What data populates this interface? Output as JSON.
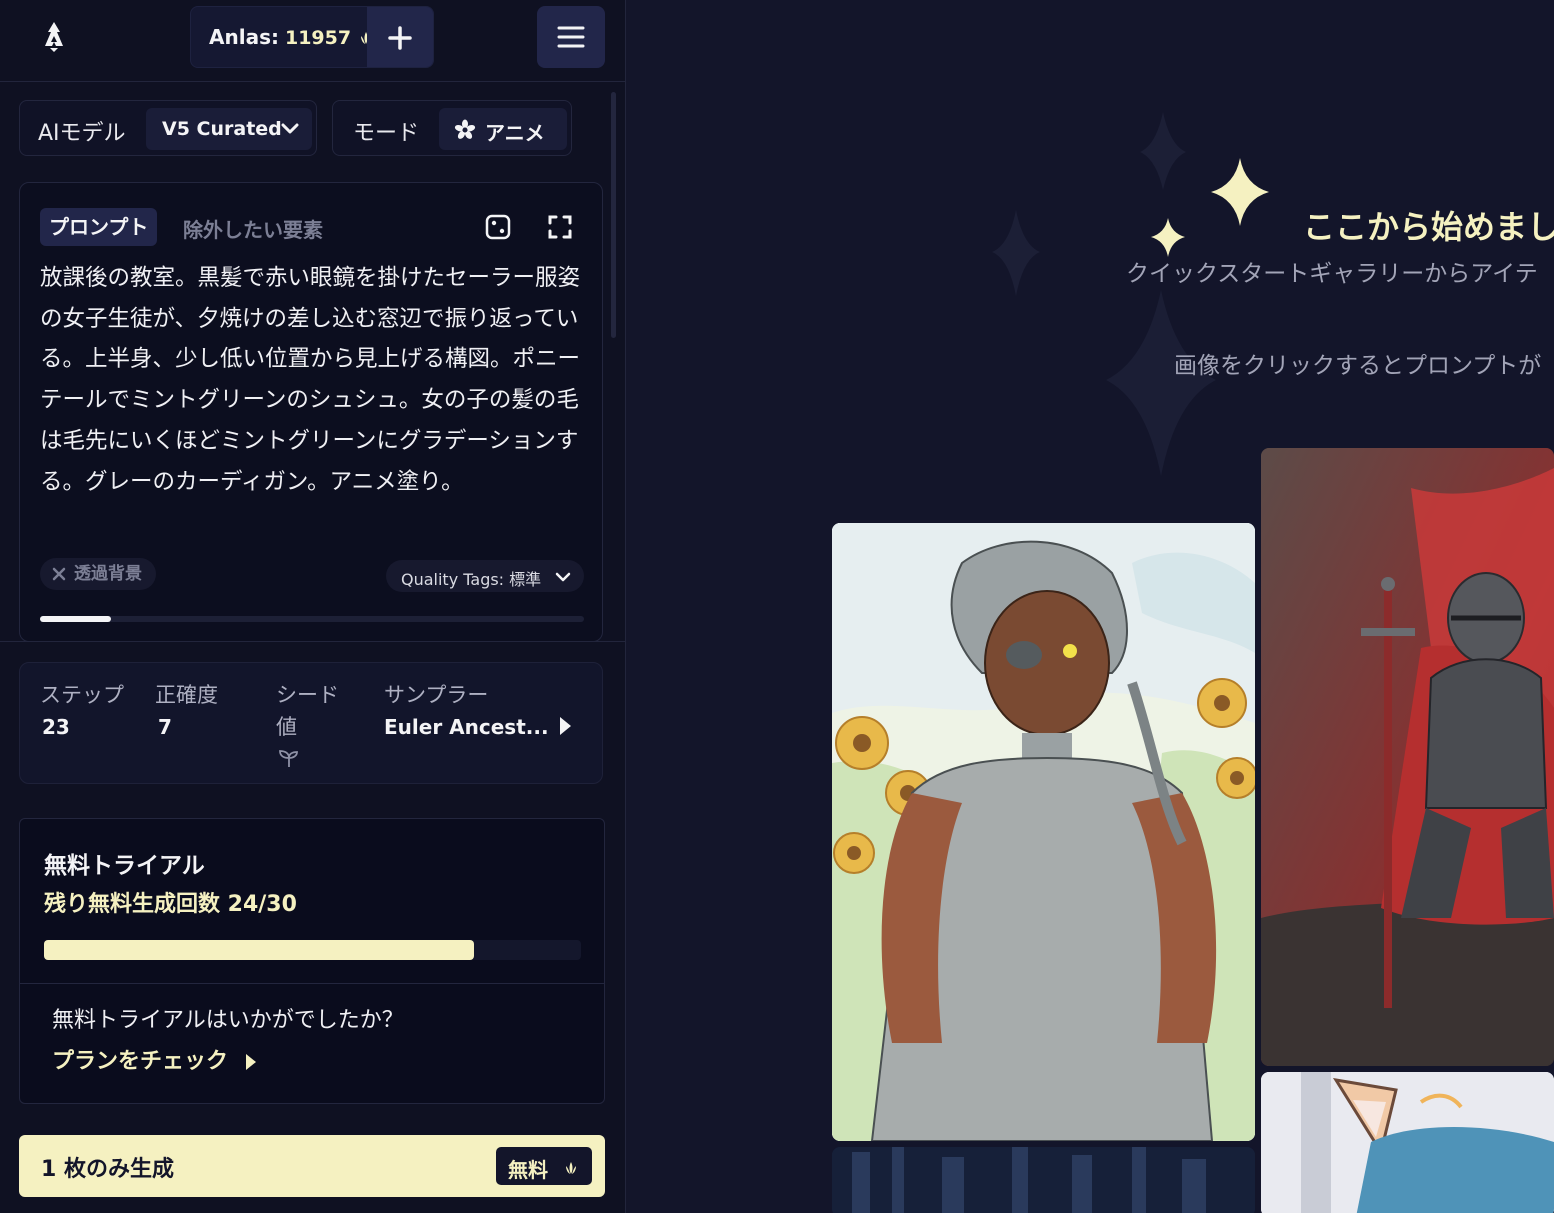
{
  "header": {
    "anlas_label": "Anlas:",
    "anlas_value": "11957"
  },
  "settings": {
    "model_label": "AIモデル",
    "model_value": "V5 Curated",
    "mode_label": "モード",
    "mode_value": "アニメ"
  },
  "prompt": {
    "tab_prompt": "プロンプト",
    "tab_negative": "除外したい要素",
    "text": "放課後の教室。黒髪で赤い眼鏡を掛けたセーラー服姿の女子生徒が、夕焼けの差し込む窓辺で振り返っている。上半身、少し低い位置から見上げる構図。ポニーテールでミントグリーンのシュシュ。女の子の髪の毛は毛先にいくほどミントグリーンにグラデーションする。グレーのカーディガン。アニメ塗り。",
    "transparent_bg": "透過背景",
    "quality_tags": "Quality Tags: 標準",
    "token_progress": 0.13
  },
  "params": {
    "steps_label": "ステップ",
    "steps_value": "23",
    "guidance_label": "正確度",
    "guidance_value": "7",
    "seed_label": "シード値",
    "sampler_label": "サンプラー",
    "sampler_value": "Euler Ancest..."
  },
  "trial": {
    "title": "無料トライアル",
    "remaining": "残り無料生成回数 24/30",
    "used": 24,
    "total": 30,
    "question": "無料トライアルはいかがでしたか？",
    "plan_link": "プランをチェック"
  },
  "generate": {
    "label": "1 枚のみ生成",
    "badge": "無料"
  },
  "hero": {
    "title": "ここから始めまし",
    "subtitle": "クイックスタートギャラリーからアイテ",
    "hint": "画像をクリックするとプロンプトが"
  },
  "colors": {
    "background": "#13152a",
    "sidebar": "#0f1122",
    "accent": "#f5f1c1",
    "button": "#22264a"
  },
  "icons": [
    "logo-icon",
    "anlas-icon",
    "plus-icon",
    "menu-icon",
    "chevron-down-icon",
    "flower-icon",
    "dice-icon",
    "expand-icon",
    "close-icon",
    "seedling-icon",
    "play-arrow-icon",
    "sparkle-icon"
  ]
}
